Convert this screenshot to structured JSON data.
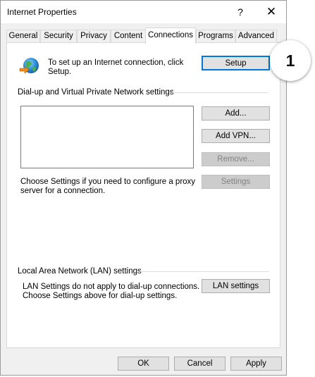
{
  "window": {
    "title": "Internet Properties",
    "help_glyph": "?",
    "close_glyph": "✕"
  },
  "tabs": [
    {
      "label": "General"
    },
    {
      "label": "Security"
    },
    {
      "label": "Privacy"
    },
    {
      "label": "Content"
    },
    {
      "label": "Connections",
      "active": true
    },
    {
      "label": "Programs"
    },
    {
      "label": "Advanced"
    }
  ],
  "setup_section": {
    "text_line1": "To set up an Internet connection, click",
    "text_line2": "Setup.",
    "button": "Setup"
  },
  "dialup_section": {
    "heading": "Dial-up and Virtual Private Network settings",
    "buttons": {
      "add": "Add...",
      "add_vpn": "Add VPN...",
      "remove": "Remove...",
      "settings": "Settings"
    },
    "proxy_text_line1": "Choose Settings if you need to configure a proxy",
    "proxy_text_line2": "server for a connection."
  },
  "lan_section": {
    "heading": "Local Area Network (LAN) settings",
    "text_line1": "LAN Settings do not apply to dial-up connections.",
    "text_line2": "Choose Settings above for dial-up settings.",
    "button": "LAN settings"
  },
  "footer": {
    "ok": "OK",
    "cancel": "Cancel",
    "apply": "Apply"
  },
  "annotation": {
    "step_number": "1"
  },
  "colors": {
    "focus_border": "#0078d7",
    "dialog_bg": "#f0f0f0",
    "panel_bg": "#ffffff",
    "disabled_text": "#838383"
  }
}
